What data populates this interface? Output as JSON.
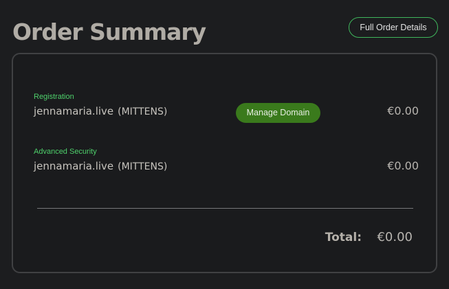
{
  "header": {
    "title": "Order Summary",
    "full_details_label": "Full Order Details"
  },
  "order": {
    "items": [
      {
        "label": "Registration",
        "domain": "jennamaria.live",
        "tag": "(MITTENS)",
        "price": "€0.00",
        "action_label": "Manage Domain"
      },
      {
        "label": "Advanced Security",
        "domain": "jennamaria.live",
        "tag": "(MITTENS)",
        "price": "€0.00"
      }
    ],
    "total_label": "Total:",
    "total_value": "€0.00"
  },
  "colors": {
    "background": "#1c1d1f",
    "accent_green": "#4ed06b",
    "button_green": "#3a7a1c",
    "card_border": "#404143"
  }
}
